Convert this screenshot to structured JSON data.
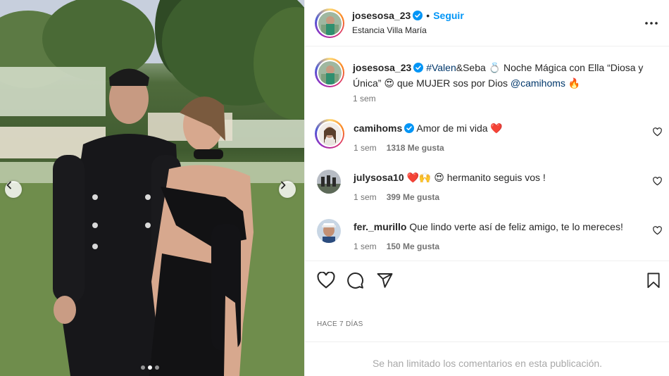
{
  "post": {
    "author": "josesosa_23",
    "follow_label": "Seguir",
    "separator": "•",
    "location": "Estancia Villa María",
    "caption": {
      "hashtag": "#Valen",
      "text1": "&Seba 💍 Noche Mágica con Ella “Diosa y Única” 😍 que MUJER sos por Dios ",
      "mention": "@camihoms",
      "text2": " 🔥",
      "time": "1 sem"
    },
    "date": "HACE 7 DÍAS",
    "comments_limited": "Se han limitado los comentarios en esta publicación."
  },
  "comments": [
    {
      "user": "camihoms",
      "verified": true,
      "text": "Amor de mi vida ❤️",
      "time": "1 sem",
      "likes": "1318 Me gusta"
    },
    {
      "user": "julysosa10",
      "verified": false,
      "text": "❤️🙌 😍 hermanito seguis vos !",
      "time": "1 sem",
      "likes": "399 Me gusta"
    },
    {
      "user": "fer._murillo",
      "verified": false,
      "text": "Que lindo verte así de feliz amigo, te lo mereces!",
      "time": "1 sem",
      "likes": "150 Me gusta"
    }
  ],
  "carousel": {
    "total": 3,
    "active": 1
  },
  "colors": {
    "accent": "#0095f6",
    "link": "#00376b",
    "muted": "#737373",
    "border": "#efefef",
    "like": "#ed4956"
  },
  "icons": [
    "chevron-left-icon",
    "chevron-right-icon",
    "more-icon",
    "verified-icon",
    "heart-icon",
    "comment-icon",
    "share-icon",
    "bookmark-icon"
  ]
}
